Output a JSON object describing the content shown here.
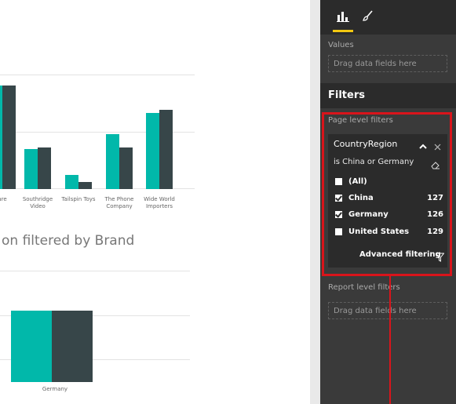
{
  "report_canvas": {
    "top_chart": {
      "categories": [
        "are",
        "Southridge Video",
        "Tailspin Toys",
        "The Phone Company",
        "Wide World Importers"
      ]
    },
    "bottom_chart": {
      "title": "on filtered by Brand",
      "category": "Germany"
    }
  },
  "chart_data": [
    {
      "type": "bar",
      "categories": [
        "are",
        "Southridge Video",
        "Tailspin Toys",
        "The Phone Company",
        "Wide World Importers"
      ],
      "series": [
        {
          "values": [
            60,
            23,
            8,
            32,
            44
          ]
        },
        {
          "values": [
            60,
            24,
            4,
            24,
            46
          ]
        }
      ]
    },
    {
      "type": "bar",
      "categories": [
        "Germany"
      ],
      "series": [
        {
          "values": [
            91
          ]
        },
        {
          "values": [
            91
          ]
        }
      ]
    }
  ],
  "pane": {
    "tabs": [
      {
        "icon": "bar-chart-icon",
        "active": true
      },
      {
        "icon": "paintbrush-icon",
        "active": false
      }
    ],
    "values_label": "Values",
    "values_dropzone": "Drag data fields here",
    "filters_title": "Filters",
    "page_level_label": "Page level filters",
    "filter_card": {
      "field": "CountryRegion",
      "condition": "is China or Germany",
      "items": [
        {
          "label": "(All)",
          "count": "",
          "checked": false
        },
        {
          "label": "China",
          "count": "127",
          "checked": true
        },
        {
          "label": "Germany",
          "count": "126",
          "checked": true
        },
        {
          "label": "United States",
          "count": "129",
          "checked": false
        }
      ],
      "advanced": "Advanced filtering"
    },
    "report_level_label": "Report level filters",
    "report_dropzone": "Drag data fields here"
  },
  "colors": {
    "series_1": "#01b8aa",
    "series_2": "#374649",
    "highlight": "#d9141b",
    "active_tab": "#f2c811"
  }
}
